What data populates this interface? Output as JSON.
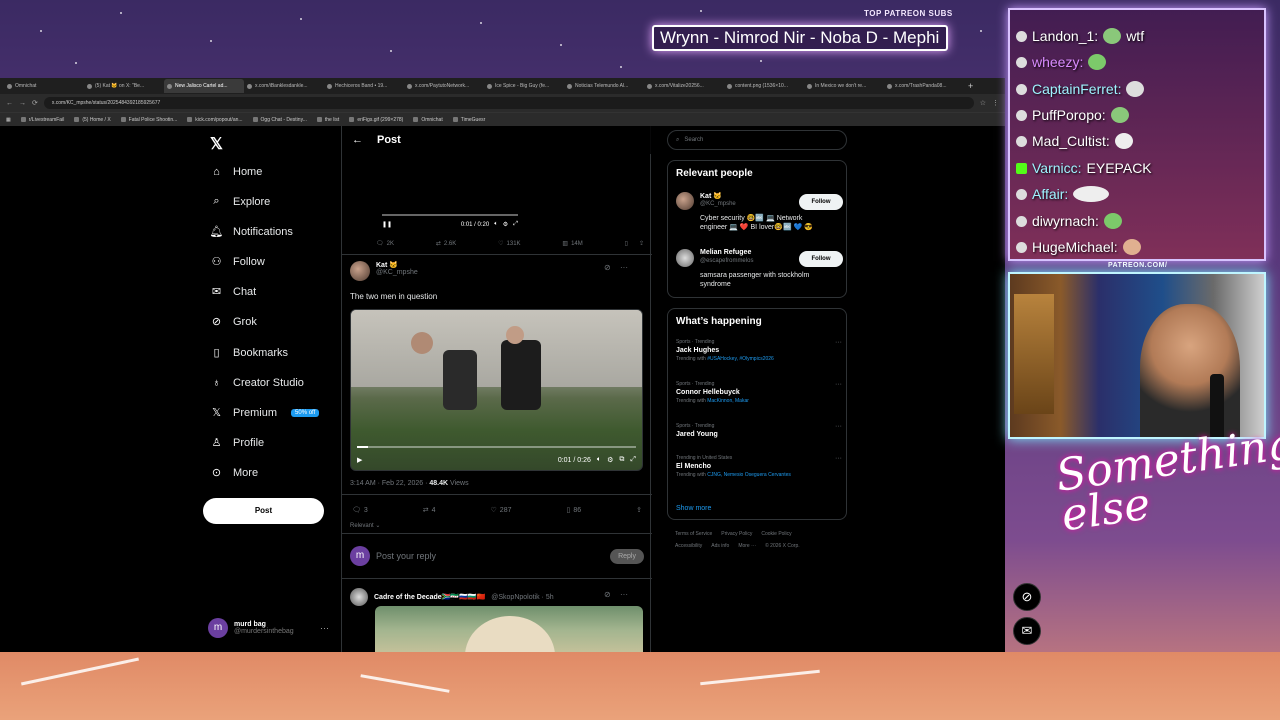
{
  "overlay": {
    "patreon_label": "TOP PATREON SUBS",
    "ticker": "Wrynn - Nimrod Nir - Noba D - Mephi",
    "patreon_url": "PATREON.COM/",
    "signature": "Something else"
  },
  "tabs": [
    {
      "label": "Omnichat"
    },
    {
      "label": "(5) Kat 🐱 on X: \"Be..."
    },
    {
      "label": "New Jalisco Cartel ad...",
      "active": true
    },
    {
      "label": "x.com/iBanklesdankle..."
    },
    {
      "label": "Hechiceros Band • 19..."
    },
    {
      "label": "x.com/PaytutoNetwork..."
    },
    {
      "label": "Ice Spice - Big Guy (fe..."
    },
    {
      "label": "Noticias Telemundo Al..."
    },
    {
      "label": "x.com/Vitalize20256..."
    },
    {
      "label": "content.png (1536×10..."
    },
    {
      "label": "In Mexico we don't re..."
    },
    {
      "label": "x.com/TrashPanda08..."
    }
  ],
  "url": "x.com/KC_mpshe/status/2025484392185925677",
  "bookmarks": [
    "r/LivestreamFail",
    "(5) Home / X",
    "Fatal Police Shootin...",
    "kick.com/popout/an...",
    "Ogg Chat - Destiny...",
    "the list",
    "eriFigs.gif (299×278)",
    "Omnichat",
    "TimeGuesr"
  ],
  "nav": {
    "items": [
      "Home",
      "Explore",
      "Notifications",
      "Follow",
      "Chat",
      "Grok",
      "Bookmarks",
      "Creator Studio",
      "Premium",
      "Profile",
      "More"
    ],
    "premium_badge": "50% off",
    "post_label": "Post",
    "account_name": "murd bag",
    "account_handle": "@murdersinthebag"
  },
  "main": {
    "header": "Post",
    "top_video_time": "0:01 / 0:20",
    "top_metrics": {
      "replies": "2K",
      "reposts": "2.6K",
      "likes": "131K",
      "views": "14M"
    },
    "tweet": {
      "name": "Kat 🐱",
      "handle": "@KC_mpshe",
      "text": "The two men in question",
      "video_time": "0:01 / 0:26",
      "video_progress": 0.04,
      "timestamp": "3:14 AM · Feb 22, 2026 · ",
      "views_count": "48.4K",
      "views_label": " Views",
      "replies": "3",
      "reposts": "4",
      "likes": "287",
      "bookmarks": "86"
    },
    "relevant_label": "Relevant ⌄",
    "reply_placeholder": "Post your reply",
    "reply_button": "Reply",
    "reply2": {
      "name": "Cadre of the Decade🇿🇦🇸🇾🇷🇺🇧🇬🇨🇳",
      "handle": "@SkopNpolotik · 5h"
    }
  },
  "right": {
    "search_placeholder": "Search",
    "relevant_title": "Relevant people",
    "people": [
      {
        "name": "Kat 🐱",
        "handle": "@KC_mpshe",
        "bio": "Cyber security 🤓🔤 💻 Network engineer 💻 ❤️ BI lover🤓🔤 💙 😎",
        "follow": "Follow"
      },
      {
        "name": "Melian Refugee",
        "handle": "@escapefrommelos",
        "bio": "samsara passenger with stockholm syndrome",
        "follow": "Follow"
      }
    ],
    "happening_title": "What’s happening",
    "trends": [
      {
        "cat": "Sports · Trending",
        "title": "Jack Hughes",
        "with_label": "Trending with ",
        "with": "#USAHockey, #Olympics2026"
      },
      {
        "cat": "Sports · Trending",
        "title": "Connor Hellebuyck",
        "with_label": "Trending with ",
        "with": "MacKinnon, Makar"
      },
      {
        "cat": "Sports · Trending",
        "title": "Jared Young",
        "with_label": "",
        "with": ""
      },
      {
        "cat": "Trending in United States",
        "title": "El Mencho",
        "with_label": "Trending with ",
        "with": "CJNG, Nemesio Oseguera Cervantes"
      }
    ],
    "show_more": "Show more",
    "footer": [
      "Terms of Service",
      "Privacy Policy",
      "Cookie Policy",
      "Accessibility",
      "Ads info",
      "More ···",
      "© 2026 X Corp."
    ]
  },
  "chat": [
    {
      "user": "Landon_1:",
      "msg": "wtf",
      "color": "#ffffff"
    },
    {
      "user": "wheezy:",
      "msg": "",
      "color": "#d98cff"
    },
    {
      "user": "CaptainFerret:",
      "msg": "",
      "color": "#9ff3ff"
    },
    {
      "user": "PuffPoropo:",
      "msg": "",
      "color": "#ffffff"
    },
    {
      "user": "Mad_Cultist:",
      "msg": "",
      "color": "#ffffff"
    },
    {
      "user": "Varnicc:",
      "msg": "EYEPACK",
      "color": "#9ff3ff"
    },
    {
      "user": "Affair:",
      "msg": "",
      "color": "#9ff3ff"
    },
    {
      "user": "diwyrnach:",
      "msg": "",
      "color": "#ffffff"
    },
    {
      "user": "HugeMichael:",
      "msg": "",
      "color": "#ffffff"
    }
  ]
}
